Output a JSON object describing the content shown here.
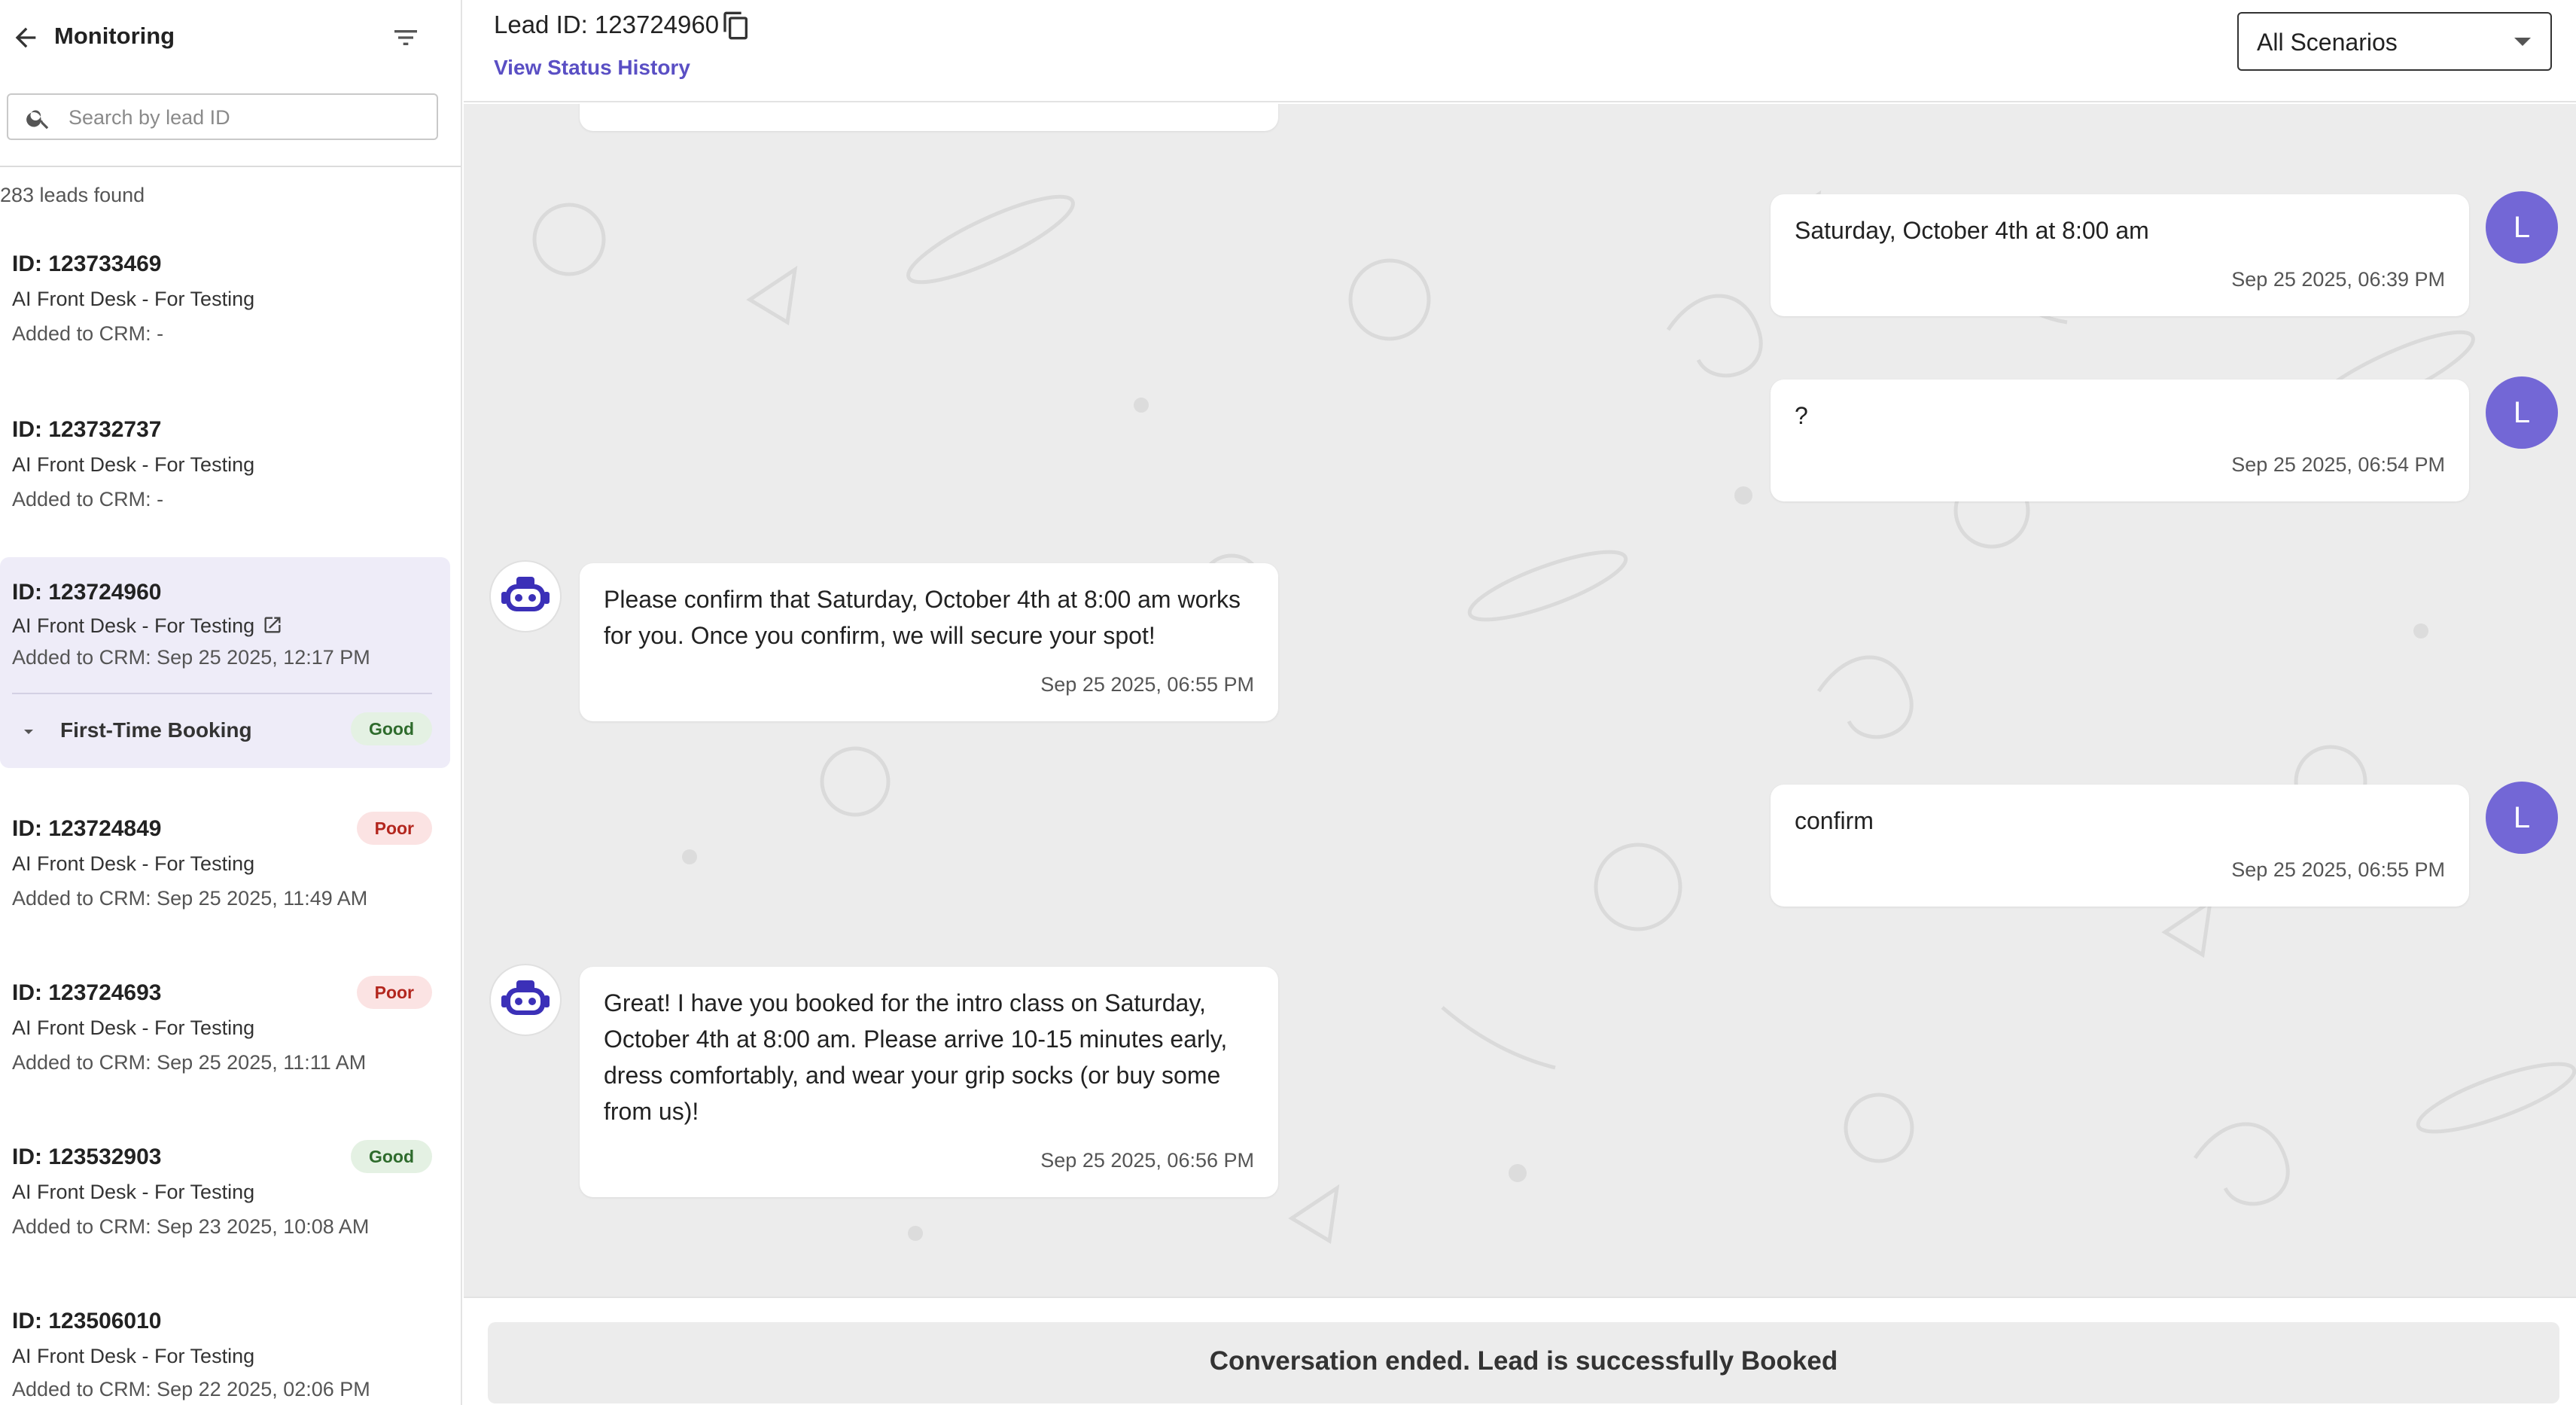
{
  "sidebar": {
    "title": "Monitoring",
    "search_placeholder": "Search by lead ID",
    "count_text": "283 leads found",
    "leads": [
      {
        "id": "ID: 123733469",
        "campaign": "AI Front Desk - For Testing",
        "crm": "Added to CRM: -",
        "badge": ""
      },
      {
        "id": "ID: 123732737",
        "campaign": "AI Front Desk - For Testing",
        "crm": "Added to CRM: -",
        "badge": ""
      },
      {
        "id": "ID: 123724960",
        "campaign": "AI Front Desk - For Testing",
        "crm": "Added to CRM: Sep 25 2025, 12:17 PM",
        "badge": "",
        "scenario": "First-Time Booking",
        "scenario_badge": "Good"
      },
      {
        "id": "ID: 123724849",
        "campaign": "AI Front Desk - For Testing",
        "crm": "Added to CRM: Sep 25 2025, 11:49 AM",
        "badge": "Poor"
      },
      {
        "id": "ID: 123724693",
        "campaign": "AI Front Desk - For Testing",
        "crm": "Added to CRM: Sep 25 2025, 11:11 AM",
        "badge": "Poor"
      },
      {
        "id": "ID: 123532903",
        "campaign": "AI Front Desk - For Testing",
        "crm": "Added to CRM: Sep 23 2025, 10:08 AM",
        "badge": "Good"
      },
      {
        "id": "ID: 123506010",
        "campaign": "AI Front Desk - For Testing",
        "crm": "Added to CRM: Sep 22 2025, 02:06 PM",
        "badge": ""
      }
    ]
  },
  "header": {
    "lead_title": "Lead ID: 123724960",
    "status_link": "View Status History",
    "scenario_select": "All Scenarios"
  },
  "messages": [
    {
      "from": "lead",
      "avatar": "L",
      "text": "Saturday, October 4th at 8:00 am",
      "time": "Sep 25 2025, 06:39 PM"
    },
    {
      "from": "lead",
      "avatar": "L",
      "text": "?",
      "time": "Sep 25 2025, 06:54 PM"
    },
    {
      "from": "bot",
      "text_lines": [
        "Please confirm that Saturday, October 4th at 8:00 am works",
        "for you. Once you confirm, we will secure your spot!"
      ],
      "time": "Sep 25 2025, 06:55 PM"
    },
    {
      "from": "lead",
      "avatar": "L",
      "text": "confirm",
      "time": "Sep 25 2025, 06:55 PM"
    },
    {
      "from": "bot",
      "text_lines": [
        "Great! I have you booked for the intro class on Saturday,",
        "October 4th at 8:00 am. Please arrive 10-15 minutes early,",
        "dress comfortably, and wear your grip socks (or buy some",
        "from us)!"
      ],
      "time": "Sep 25 2025, 06:56 PM"
    }
  ],
  "footer": {
    "ended_text": "Conversation ended. Lead is successfully Booked"
  },
  "colors": {
    "accent": "#7367d6",
    "link": "#5a4fc4",
    "selected_bg": "#eeecf8",
    "chat_bg": "#ececec",
    "poor_bg": "#fbe3e3",
    "good_bg": "#e4f1e3"
  },
  "icons": [
    "back-arrow-icon",
    "filter-icon",
    "search-icon",
    "external-link-icon",
    "caret-down-icon",
    "copy-icon",
    "chevron-down-icon",
    "bot-icon"
  ]
}
